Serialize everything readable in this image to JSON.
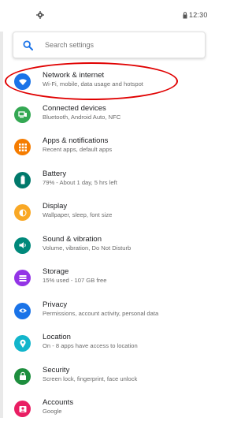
{
  "statusbar": {
    "time": "12:30"
  },
  "search": {
    "placeholder": "Search settings"
  },
  "items": [
    {
      "title": "Network & internet",
      "subtitle": "Wi-Fi, mobile, data usage and hotspot",
      "color": "#1a73e8",
      "icon": "wifi-icon"
    },
    {
      "title": "Connected devices",
      "subtitle": "Bluetooth, Android Auto, NFC",
      "color": "#34a853",
      "icon": "devices-icon"
    },
    {
      "title": "Apps & notifications",
      "subtitle": "Recent apps, default apps",
      "color": "#f57c00",
      "icon": "apps-grid-icon"
    },
    {
      "title": "Battery",
      "subtitle": "79% - About 1 day, 5 hrs left",
      "color": "#00796b",
      "icon": "battery-icon"
    },
    {
      "title": "Display",
      "subtitle": "Wallpaper, sleep, font size",
      "color": "#f9a825",
      "icon": "brightness-icon"
    },
    {
      "title": "Sound & vibration",
      "subtitle": "Volume, vibration, Do Not Disturb",
      "color": "#00897b",
      "icon": "speaker-icon"
    },
    {
      "title": "Storage",
      "subtitle": "15% used - 107 GB free",
      "color": "#9334e6",
      "icon": "storage-icon"
    },
    {
      "title": "Privacy",
      "subtitle": "Permissions, account activity, personal data",
      "color": "#1a73e8",
      "icon": "privacy-eye-icon"
    },
    {
      "title": "Location",
      "subtitle": "On - 8 apps have access to location",
      "color": "#12b5cb",
      "icon": "location-pin-icon"
    },
    {
      "title": "Security",
      "subtitle": "Screen lock, fingerprint, face unlock",
      "color": "#1e8e3e",
      "icon": "lock-icon"
    },
    {
      "title": "Accounts",
      "subtitle": "Google",
      "color": "#e91e63",
      "icon": "account-icon"
    }
  ],
  "annotation_color": "#e00000"
}
